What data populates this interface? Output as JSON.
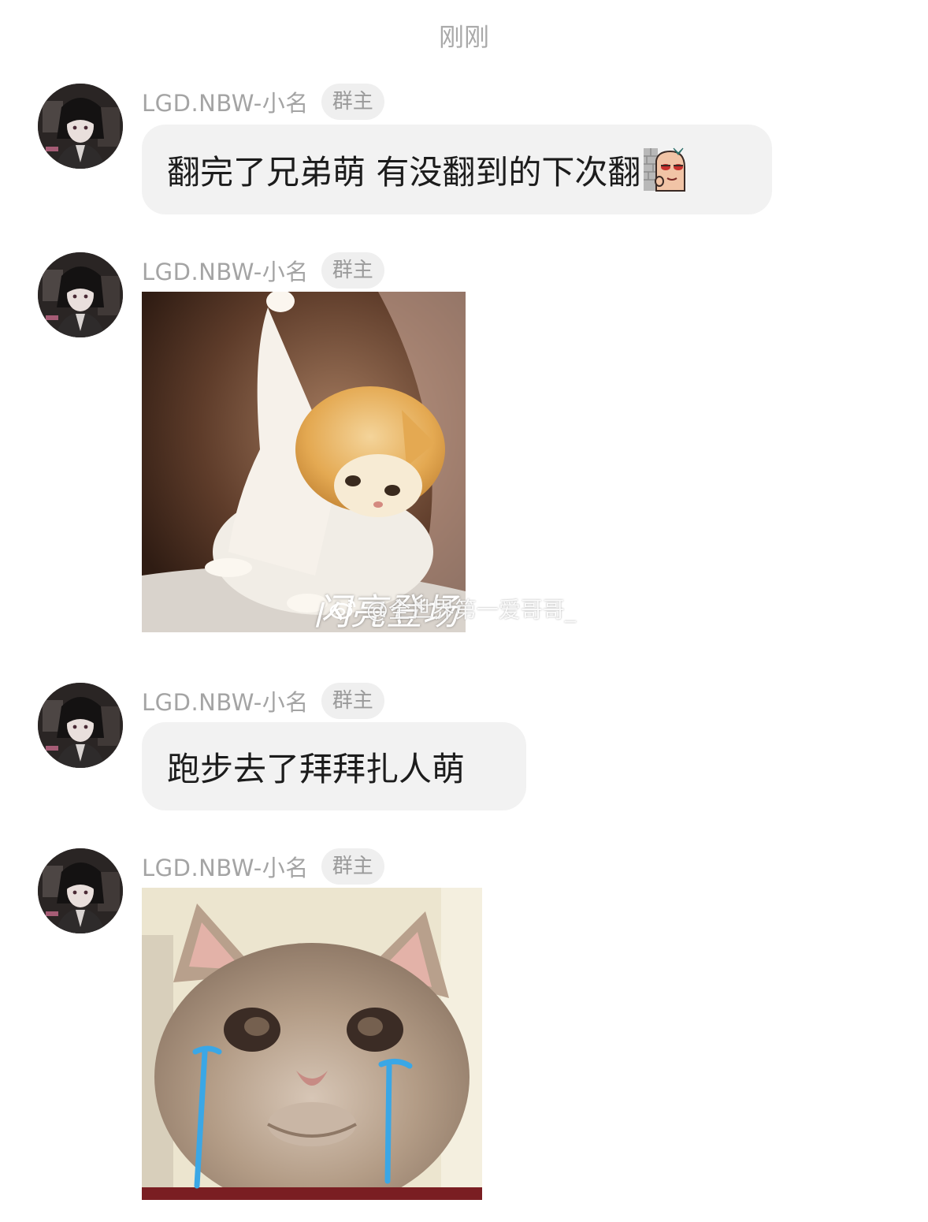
{
  "timestamp": "刚刚",
  "messages": [
    {
      "sender": "LGD.NBW-小名",
      "badge": "群主",
      "type": "text",
      "text": "翻完了兄弟萌 有没翻到的下次翻",
      "emoji": "peeking-sausage-emoji"
    },
    {
      "sender": "LGD.NBW-小名",
      "badge": "群主",
      "type": "image",
      "image": "orange-kitten-sticker",
      "caption": "闪亮登场"
    },
    {
      "sender": "LGD.NBW-小名",
      "badge": "群主",
      "type": "text",
      "text": "跑步去了拜拜扎人萌"
    },
    {
      "sender": "LGD.NBW-小名",
      "badge": "群主",
      "type": "image",
      "image": "crying-cat-sticker"
    }
  ],
  "watermark": "@全世界第一爱哥哥_"
}
